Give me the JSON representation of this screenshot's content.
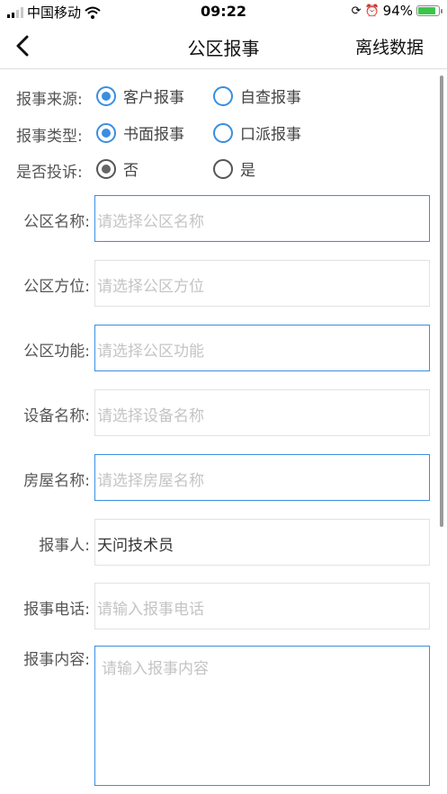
{
  "status_bar": {
    "carrier": "中国移动",
    "time": "09:22",
    "battery": "94%",
    "battery_level": 0.94
  },
  "nav": {
    "title": "公区报事",
    "offline_data": "离线数据"
  },
  "radio_groups": [
    {
      "label": "报事来源:",
      "options": [
        "客户报事",
        "自查报事"
      ],
      "selected": 0
    },
    {
      "label": "报事类型:",
      "options": [
        "书面报事",
        "口派报事"
      ],
      "selected": 0
    },
    {
      "label": "是否投诉:",
      "options": [
        "否",
        "是"
      ],
      "selected": 0
    }
  ],
  "fields": {
    "area_name": {
      "label": "公区名称:",
      "placeholder": "请选择公区名称"
    },
    "area_position": {
      "label": "公区方位:",
      "placeholder": "请选择公区方位"
    },
    "area_function": {
      "label": "公区功能:",
      "placeholder": "请选择公区功能"
    },
    "device_name": {
      "label": "设备名称:",
      "placeholder": "请选择设备名称"
    },
    "house_name": {
      "label": "房屋名称:",
      "placeholder": "请选择房屋名称"
    },
    "reporter": {
      "label": "报事人:",
      "value": "天问技术员"
    },
    "phone": {
      "label": "报事电话:",
      "placeholder": "请输入报事电话"
    },
    "content": {
      "label": "报事内容:",
      "placeholder": "请输入报事内容"
    }
  }
}
